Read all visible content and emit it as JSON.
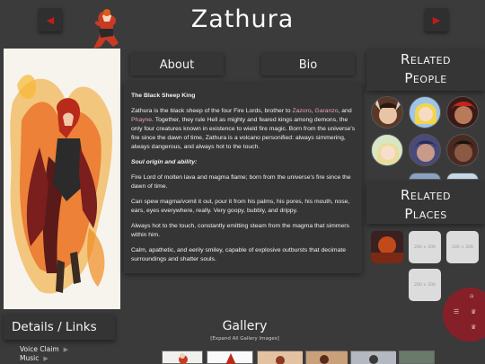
{
  "header": {
    "title": "Zathura",
    "prev_glyph": "◀",
    "next_glyph": "▶"
  },
  "tabs": {
    "about": "About",
    "bio": "Bio"
  },
  "about": {
    "heading": "The Black Sheep King",
    "p1_pre": "Zathura is the black sheep of the four Fire Lords, brother to ",
    "link_zazoro": "Zazoro",
    "sep1": ", ",
    "link_garanzo": "Garanzo",
    "sep2": ",",
    "p1_and": "and ",
    "link_phayne": "Phayne",
    "p1_post": ". Together, they rule Hell as mighty and feared kings among demons, the only four creatures known in existence to wield fire magic. Born from the universe's fire since the dawn of time, Zathura is a volcano personified: always simmering, always dangerous, and always hot to the touch.",
    "subheading": "Soul origin and ability:",
    "p2": "Fire Lord of molten lava and magma flame; born from the universe's fire since the dawn of time.",
    "p3": "Can spew magma/vomit it out, pour it from his palms, his pores, his mouth, nose, ears, eyes everywhere, really. Very goopy, bubbly, and drippy.",
    "p4": "Always hot to the touch, constantly emitting steam from the magma that simmers within him.",
    "p5": "Calm, apathetic, and eerily smiley, capable of explosive outbursts that decimate surroundings and shatter souls."
  },
  "related_people": {
    "title_line1": "Related",
    "title_line2": "People"
  },
  "related_places": {
    "title_line1": "Related",
    "title_line2": "Places",
    "placeholder_label": "200 × 200"
  },
  "details": {
    "title": "Details / Links",
    "links": [
      {
        "label": "Voice Claim",
        "arrow": "▶"
      },
      {
        "label": "Music",
        "arrow": "▶"
      }
    ]
  },
  "gallery": {
    "title": "Gallery",
    "expand": "[Expand All Gallery Images]"
  },
  "colors": {
    "background": "#3a3a3a",
    "panel": "#353535",
    "accent_red": "#c11c1c",
    "link_pink": "#e8a3b4",
    "wheel": "#8e1e28"
  }
}
